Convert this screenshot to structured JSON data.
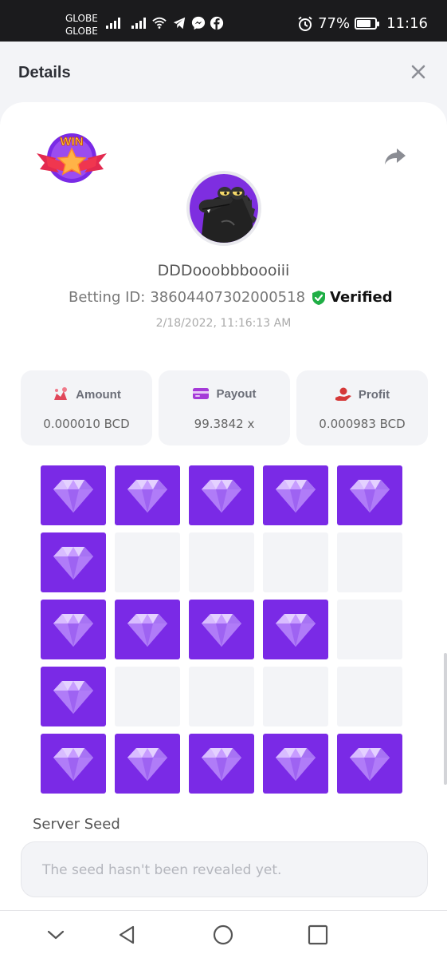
{
  "status_bar": {
    "carrier_1": "GLOBE",
    "carrier_2": "GLOBE",
    "battery": "77%",
    "time": "11:16",
    "battery_level": 0.77,
    "icons": [
      "signal-icon",
      "signal-icon",
      "wifi-icon",
      "telegram-icon",
      "messenger-icon",
      "facebook-icon",
      "alarm-icon",
      "battery-icon"
    ]
  },
  "header": {
    "title": "Details",
    "close_icon": "close-icon"
  },
  "bet": {
    "username": "DDDooobbboooiii",
    "betting_id_label": "Betting ID:",
    "betting_id": "38604407302000518",
    "verified_label": "Verified",
    "datetime": "2/18/2022, 11:16:13 AM"
  },
  "stats": [
    {
      "label": "Amount",
      "value": "0.000010 BCD",
      "icon": "coins-icon",
      "color": "#e0475a"
    },
    {
      "label": "Payout",
      "value": "99.3842 x",
      "icon": "card-icon",
      "color": "#a53ad8"
    },
    {
      "label": "Profit",
      "value": "0.000983 BCD",
      "icon": "profit-hand-icon",
      "color": "#d53838"
    }
  ],
  "board": {
    "rows": [
      [
        1,
        1,
        1,
        1,
        1
      ],
      [
        1,
        0,
        0,
        0,
        0
      ],
      [
        1,
        1,
        1,
        1,
        0
      ],
      [
        1,
        0,
        0,
        0,
        0
      ],
      [
        1,
        1,
        1,
        1,
        1
      ]
    ],
    "gem_color": "#7a2ae6",
    "empty_color": "#f3f4f7"
  },
  "server_seed": {
    "label": "Server Seed",
    "placeholder": "The seed hasn't been revealed yet."
  },
  "colors": {
    "accent": "#7a2ae6",
    "verified": "#1fae45"
  }
}
